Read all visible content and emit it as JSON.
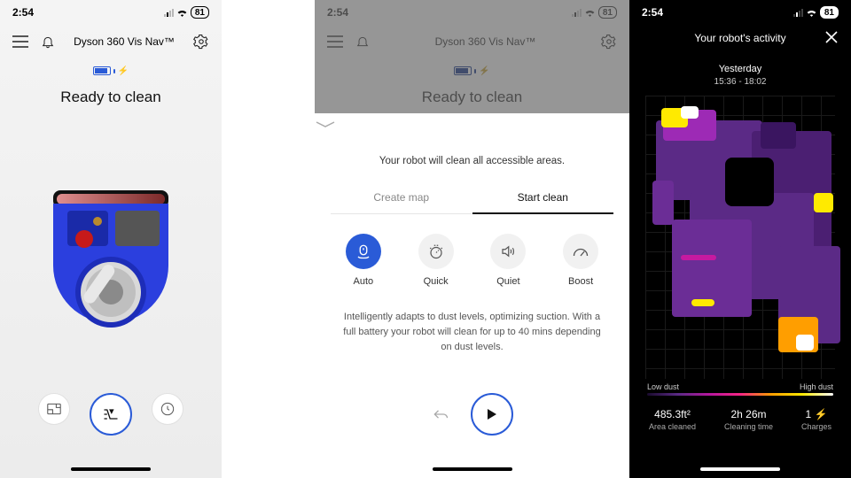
{
  "status": {
    "time": "2:54",
    "battery_pct": "81"
  },
  "device_name": "Dyson 360 Vis Nav™",
  "state_label": "Ready to clean",
  "sheet": {
    "description": "Your robot will clean all accessible areas.",
    "tabs": {
      "create_map": "Create map",
      "start_clean": "Start clean"
    },
    "modes": {
      "auto": "Auto",
      "quick": "Quick",
      "quiet": "Quiet",
      "boost": "Boost"
    },
    "mode_description": "Intelligently adapts to dust levels, optimizing suction. With a full battery your robot will clean for up to 40 mins depending on dust levels."
  },
  "activity": {
    "title": "Your robot's activity",
    "day": "Yesterday",
    "time_range": "15:36 - 18:02",
    "legend_low": "Low dust",
    "legend_high": "High dust",
    "stats": {
      "area_value": "485.3ft²",
      "area_label": "Area cleaned",
      "time_value": "2h 26m",
      "time_label": "Cleaning time",
      "charges_value": "1 ⚡",
      "charges_label": "Charges"
    }
  }
}
